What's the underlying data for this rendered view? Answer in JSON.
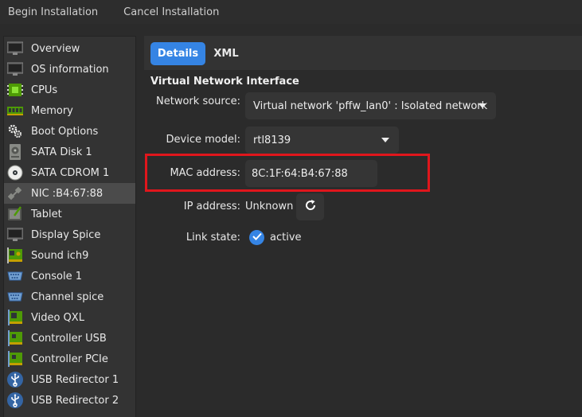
{
  "toolbar": {
    "begin_label": "Begin Installation",
    "cancel_label": "Cancel Installation"
  },
  "sidebar": {
    "items": [
      {
        "label": "Overview",
        "icon": "monitor-icon"
      },
      {
        "label": "OS information",
        "icon": "monitor-icon"
      },
      {
        "label": "CPUs",
        "icon": "cpu-icon"
      },
      {
        "label": "Memory",
        "icon": "memory-icon"
      },
      {
        "label": "Boot Options",
        "icon": "gears-icon"
      },
      {
        "label": "SATA Disk 1",
        "icon": "disk-icon"
      },
      {
        "label": "SATA CDROM 1",
        "icon": "cdrom-icon"
      },
      {
        "label": "NIC :B4:67:88",
        "icon": "network-icon",
        "selected": true
      },
      {
        "label": "Tablet",
        "icon": "tablet-icon"
      },
      {
        "label": "Display Spice",
        "icon": "monitor-icon"
      },
      {
        "label": "Sound ich9",
        "icon": "sound-card-icon"
      },
      {
        "label": "Console 1",
        "icon": "serial-port-icon"
      },
      {
        "label": "Channel spice",
        "icon": "serial-port-icon"
      },
      {
        "label": "Video QXL",
        "icon": "video-card-icon"
      },
      {
        "label": "Controller USB",
        "icon": "controller-card-icon"
      },
      {
        "label": "Controller PCIe",
        "icon": "controller-card-icon"
      },
      {
        "label": "USB Redirector 1",
        "icon": "usb-icon"
      },
      {
        "label": "USB Redirector 2",
        "icon": "usb-icon"
      }
    ]
  },
  "tabs": {
    "details": "Details",
    "xml": "XML"
  },
  "details": {
    "section_title": "Virtual Network Interface",
    "network_source_label": "Network source:",
    "network_source_value": "Virtual network 'pffw_lan0' : Isolated network",
    "device_model_label": "Device model:",
    "device_model_value": "rtl8139",
    "mac_label": "MAC address:",
    "mac_value": "8C:1F:64:B4:67:88",
    "ip_label": "IP address:",
    "ip_value": "Unknown",
    "link_label": "Link state:",
    "link_value": "active"
  },
  "colors": {
    "accent": "#3584e4",
    "highlight": "#e0161c"
  }
}
